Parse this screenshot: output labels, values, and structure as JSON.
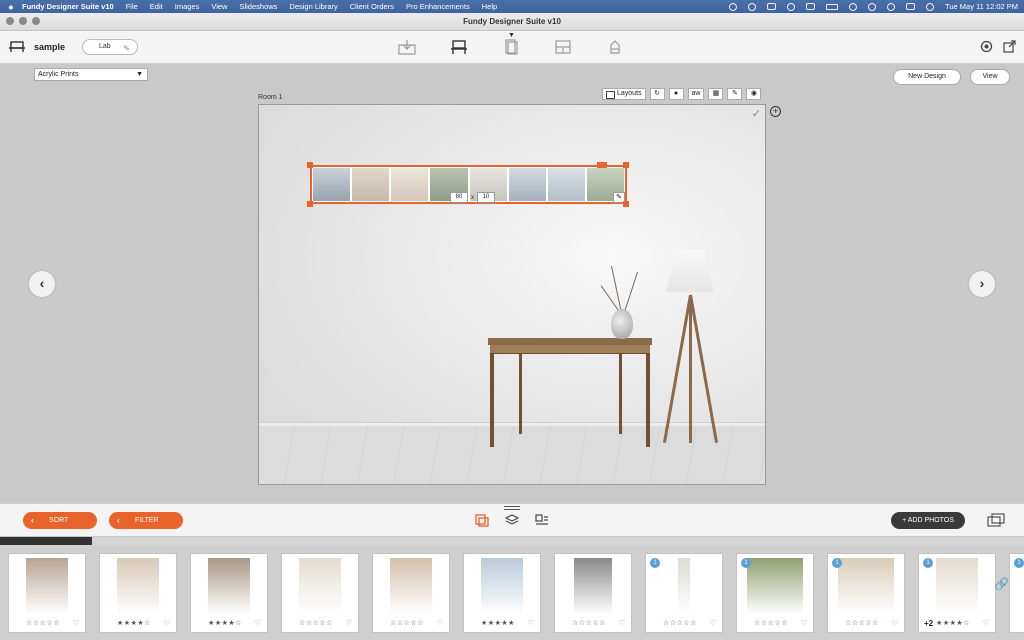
{
  "menubar": {
    "app_name": "Fundy Designer Suite v10",
    "menus": [
      "File",
      "Edit",
      "Images",
      "View",
      "Slideshows",
      "Design Library",
      "Client Orders",
      "Pro Enhancements",
      "Help"
    ],
    "clock": "Tue May 11  12:02 PM"
  },
  "window": {
    "title": "Fundy Designer Suite v10"
  },
  "toolbar": {
    "project_name": "sample",
    "lab_label": "Lab"
  },
  "workspace": {
    "product_select": "Acrylic Prints",
    "new_design_label": "New Design",
    "view_label": "View",
    "room_label": "Room 1",
    "tools": {
      "layouts_label": "Layouts",
      "aw_label": "aw"
    },
    "print": {
      "width": "80",
      "height": "10",
      "times": "x"
    }
  },
  "bottombar": {
    "sort_label": "SORT",
    "filter_label": "FILTER",
    "add_photos_label": "+ ADD PHOTOS",
    "scroll_progress": 0.09
  },
  "filmstrip": {
    "thumbs": [
      {
        "stars": "☆☆☆☆☆",
        "badge": "",
        "plus": "",
        "tone": "#b8a494"
      },
      {
        "stars": "★★★★☆",
        "badge": "",
        "plus": "",
        "tone": "#d8c8b8"
      },
      {
        "stars": "★★★★☆",
        "badge": "",
        "plus": "",
        "tone": "#a89888"
      },
      {
        "stars": "☆☆☆☆☆",
        "badge": "",
        "plus": "",
        "tone": "#e4dcd2"
      },
      {
        "stars": "☆☆☆☆☆",
        "badge": "",
        "plus": "",
        "tone": "#d4c0ac"
      },
      {
        "stars": "★★★★★",
        "badge": "",
        "plus": "",
        "tone": "#b8cad8"
      },
      {
        "stars": "☆☆☆☆☆",
        "badge": "",
        "plus": "",
        "tone": "#8a8a8a"
      },
      {
        "stars": "☆☆☆☆☆",
        "badge": "1",
        "plus": "",
        "tone": "#dcdcd4"
      },
      {
        "stars": "☆☆☆☆☆",
        "badge": "1",
        "plus": "",
        "tone": "#8fa070"
      },
      {
        "stars": "☆☆☆☆☆",
        "badge": "1",
        "plus": "",
        "tone": "#d8ccb8"
      },
      {
        "stars": "★★★★☆",
        "badge": "1",
        "plus": "+2",
        "tone": "#e4dcd0"
      },
      {
        "stars": "",
        "badge": "1",
        "plus": "",
        "tone": "#ffffff"
      }
    ]
  },
  "colors": {
    "accent": "#e8642b",
    "dark_button": "#3a3a3a",
    "badge": "#5aa0d8",
    "menubar": "#4169a2"
  }
}
